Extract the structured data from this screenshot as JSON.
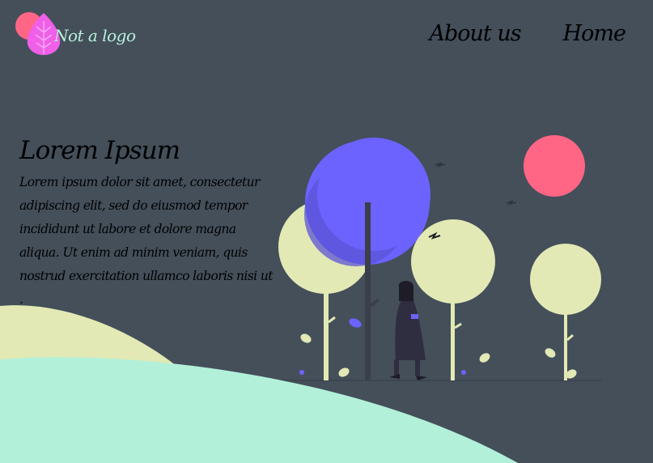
{
  "brand": {
    "logo_text": "Not a logo",
    "logo_icon": "leaf-icon",
    "colors": {
      "circle": "#ff6584",
      "leaf": "#f05fe8",
      "text": "#b7f1db"
    }
  },
  "nav": {
    "items": [
      {
        "label": "About us"
      },
      {
        "label": "Home"
      }
    ]
  },
  "hero": {
    "title": "Lorem Ipsum",
    "body": "Lorem ipsum dolor sit amet, consectetur adipiscing elit, sed do eiusmod tempor incididunt ut labore et dolore magna aliqua. Ut enim ad minim veniam, quis nostrud exercitation ullamco laboris nisi ut ."
  },
  "illustration": {
    "subject": "person walking among trees",
    "colors": {
      "background": "#444f5a",
      "tree_pale": "#e2e9b4",
      "tree_purple": "#6c63ff",
      "sun": "#ff6584",
      "hill_back": "#e2e9b4",
      "hill_front": "#b3f0da"
    }
  }
}
